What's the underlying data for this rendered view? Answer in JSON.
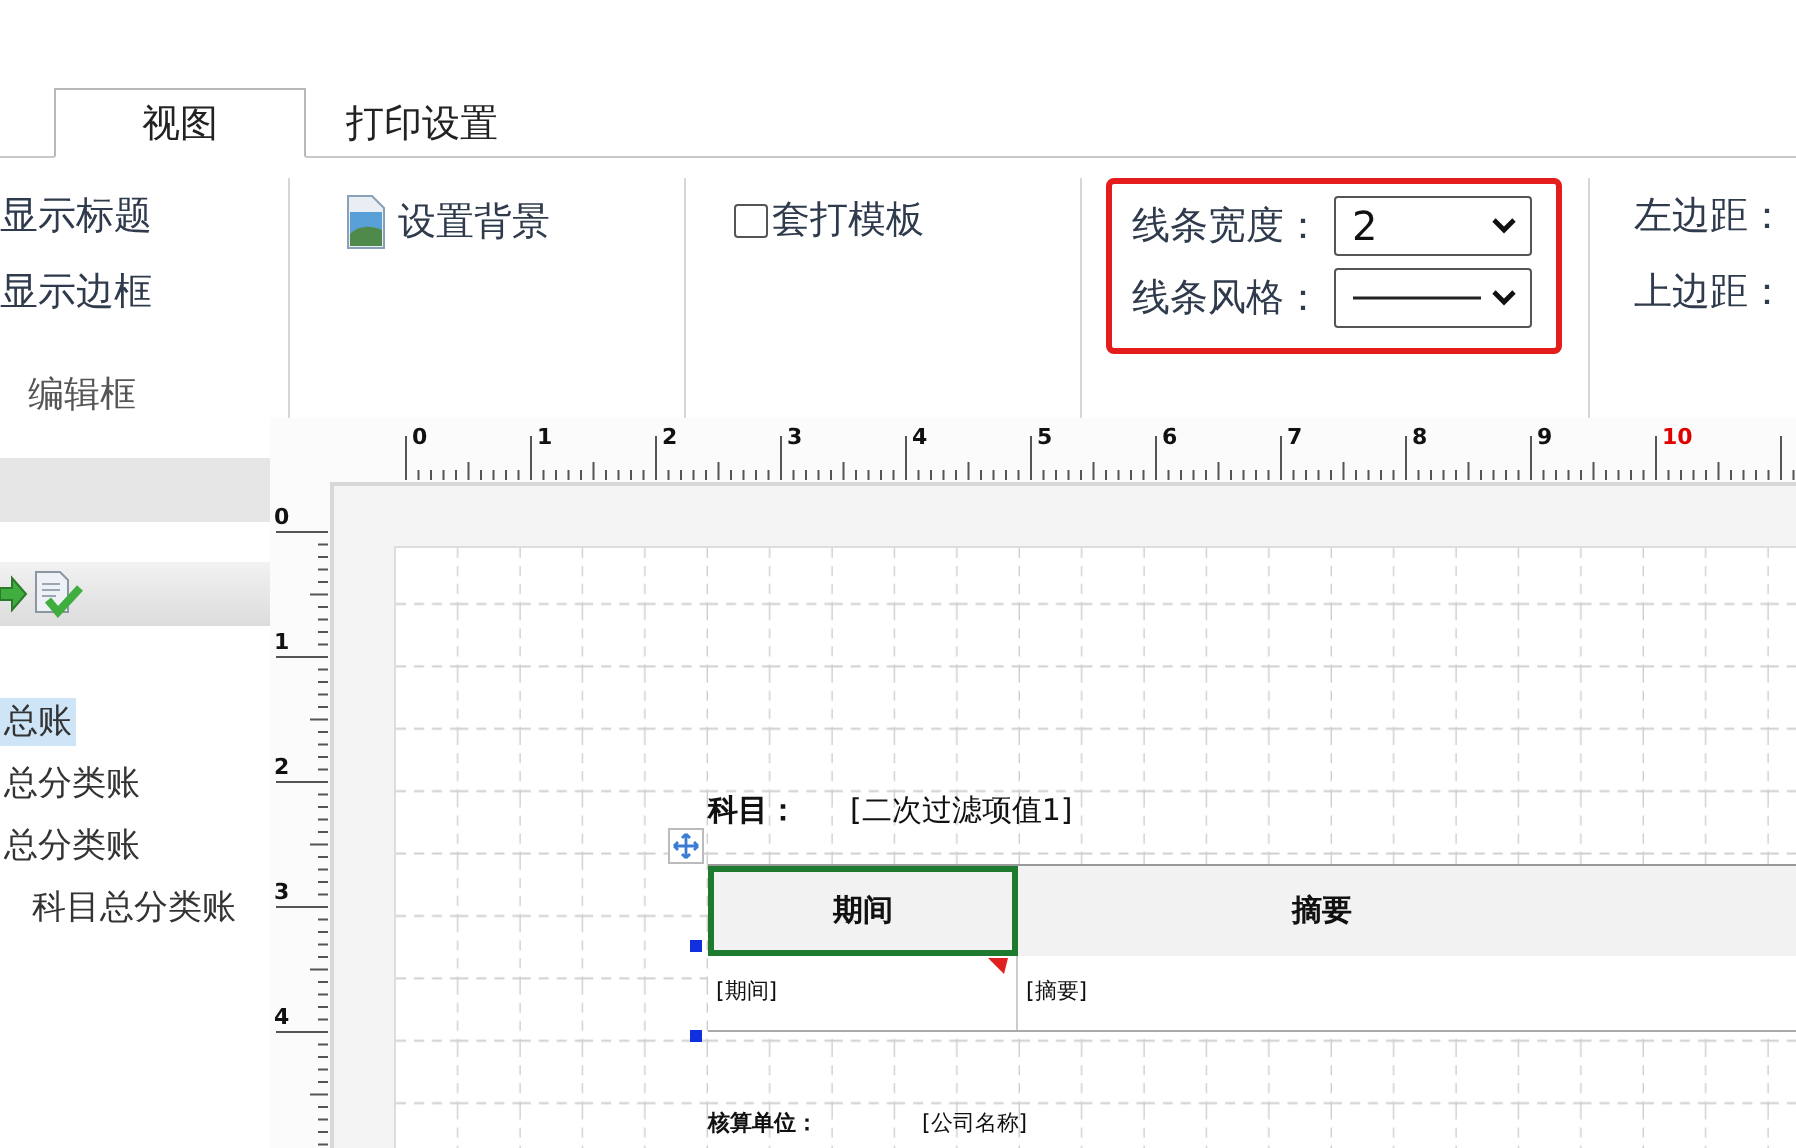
{
  "tabs": [
    {
      "label": "视图",
      "selected": true
    },
    {
      "label": "打印设置",
      "selected": false
    }
  ],
  "ribbon": {
    "groups": [
      {
        "kind": "options",
        "label": "编辑框",
        "highlighted": false,
        "items": [
          {
            "text": "显示标题"
          },
          {
            "text": "显示边框"
          }
        ]
      },
      {
        "kind": "button",
        "highlighted": false,
        "text": "设置背景"
      },
      {
        "kind": "checkbox",
        "highlighted": false,
        "text": "套打模板",
        "checked": false
      },
      {
        "kind": "selects",
        "highlighted": true,
        "fields": [
          {
            "kind": "text",
            "label": "线条宽度：",
            "value": "2"
          },
          {
            "kind": "line",
            "label": "线条风格："
          }
        ]
      },
      {
        "kind": "margins",
        "highlighted": false,
        "labels": [
          "左边距：",
          "上边距："
        ]
      }
    ]
  },
  "left_panel": {
    "items": [
      {
        "text": "总账",
        "selected": true,
        "indented": false
      },
      {
        "text": "总分类账",
        "selected": false,
        "indented": false
      },
      {
        "text": "总分类账",
        "selected": false,
        "indented": false
      },
      {
        "text": "科目总分类账",
        "selected": false,
        "indented": true
      }
    ]
  },
  "designer": {
    "h_ruler": [
      {
        "label": "0",
        "marked": false
      },
      {
        "label": "1",
        "marked": false
      },
      {
        "label": "2",
        "marked": false
      },
      {
        "label": "3",
        "marked": false
      },
      {
        "label": "4",
        "marked": false
      },
      {
        "label": "5",
        "marked": false
      },
      {
        "label": "6",
        "marked": false
      },
      {
        "label": "7",
        "marked": false
      },
      {
        "label": "8",
        "marked": false
      },
      {
        "label": "9",
        "marked": false
      },
      {
        "label": "10",
        "marked": true
      }
    ],
    "v_ruler": [
      {
        "label": "0"
      },
      {
        "label": "1"
      },
      {
        "label": "2"
      },
      {
        "label": "3"
      },
      {
        "label": "4"
      }
    ],
    "subject": {
      "label": "科目：",
      "value": "[二次过滤项值1]"
    },
    "table": {
      "headers": [
        {
          "text": "期间",
          "selected": true
        },
        {
          "text": "摘要",
          "selected": false
        }
      ],
      "row": [
        "[期间]",
        "[摘要]"
      ]
    },
    "footer": {
      "label": "核算单位：",
      "value": "[公司名称]"
    }
  }
}
